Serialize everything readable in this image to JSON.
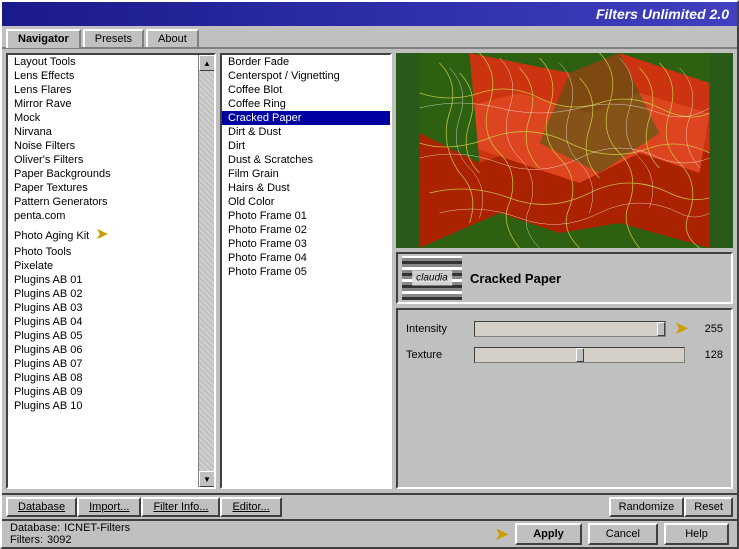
{
  "title": "Filters Unlimited 2.0",
  "tabs": [
    {
      "id": "navigator",
      "label": "Navigator",
      "active": true
    },
    {
      "id": "presets",
      "label": "Presets",
      "active": false
    },
    {
      "id": "about",
      "label": "About",
      "active": false
    }
  ],
  "left_panel": {
    "items": [
      "Layout Tools",
      "Lens Effects",
      "Lens Flares",
      "Mirror Rave",
      "Mock",
      "Nirvana",
      "Noise Filters",
      "Oliver's Filters",
      "Paper Backgrounds",
      "Paper Textures",
      "Pattern Generators",
      "penta.com",
      "Photo Aging Kit",
      "Photo Tools",
      "Pixelate",
      "Plugins AB 01",
      "Plugins AB 02",
      "Plugins AB 03",
      "Plugins AB 04",
      "Plugins AB 05",
      "Plugins AB 06",
      "Plugins AB 07",
      "Plugins AB 08",
      "Plugins AB 09",
      "Plugins AB 10"
    ],
    "selected": "Photo Aging Kit",
    "arrow_item": "Photo Aging Kit"
  },
  "middle_panel": {
    "items": [
      "Border Fade",
      "Centerspot / Vignetting",
      "Coffee Blot",
      "Coffee Ring",
      "Cracked Paper",
      "Dirt & Dust",
      "Dirt",
      "Dust & Scratches",
      "Film Grain",
      "Hairs & Dust",
      "Old Color",
      "Photo Frame 01",
      "Photo Frame 02",
      "Photo Frame 03",
      "Photo Frame 04",
      "Photo Frame 05"
    ],
    "selected": "Cracked Paper"
  },
  "filter_name": "Cracked Paper",
  "thumbnail_text": "claudia",
  "sliders": [
    {
      "label": "Intensity",
      "value": 255,
      "max": 255,
      "position": 0.98
    },
    {
      "label": "Texture",
      "value": 128,
      "max": 255,
      "position": 0.5
    }
  ],
  "toolbar": {
    "database_label": "Database",
    "import_label": "Import...",
    "filter_info_label": "Filter Info...",
    "editor_label": "Editor...",
    "randomize_label": "Randomize",
    "reset_label": "Reset"
  },
  "status": {
    "database_label": "Database:",
    "database_value": "ICNET-Filters",
    "filters_label": "Filters:",
    "filters_value": "3092"
  },
  "buttons": {
    "apply": "Apply",
    "cancel": "Cancel",
    "help": "Help"
  },
  "arrow_symbol": "➤"
}
